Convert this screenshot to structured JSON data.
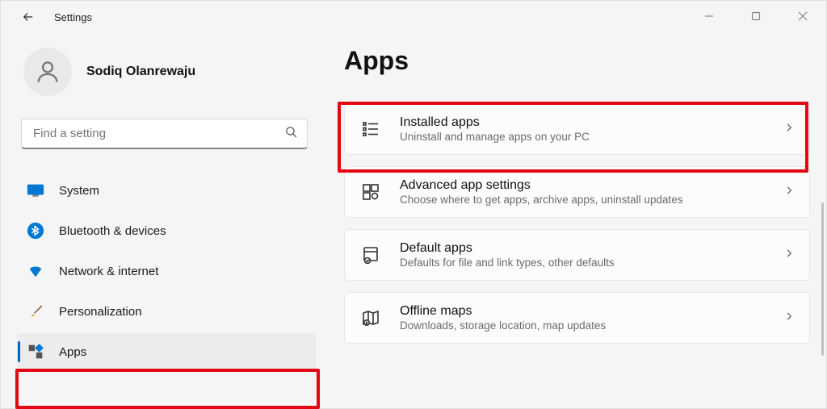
{
  "window": {
    "title": "Settings"
  },
  "profile": {
    "name": "Sodiq Olanrewaju"
  },
  "search": {
    "placeholder": "Find a setting"
  },
  "sidebar": {
    "items": {
      "0": {
        "label": "System"
      },
      "1": {
        "label": "Bluetooth & devices"
      },
      "2": {
        "label": "Network & internet"
      },
      "3": {
        "label": "Personalization"
      },
      "4": {
        "label": "Apps"
      }
    }
  },
  "page": {
    "title": "Apps"
  },
  "cards": {
    "0": {
      "title": "Installed apps",
      "sub": "Uninstall and manage apps on your PC"
    },
    "1": {
      "title": "Advanced app settings",
      "sub": "Choose where to get apps, archive apps, uninstall updates"
    },
    "2": {
      "title": "Default apps",
      "sub": "Defaults for file and link types, other defaults"
    },
    "3": {
      "title": "Offline maps",
      "sub": "Downloads, storage location, map updates"
    }
  }
}
